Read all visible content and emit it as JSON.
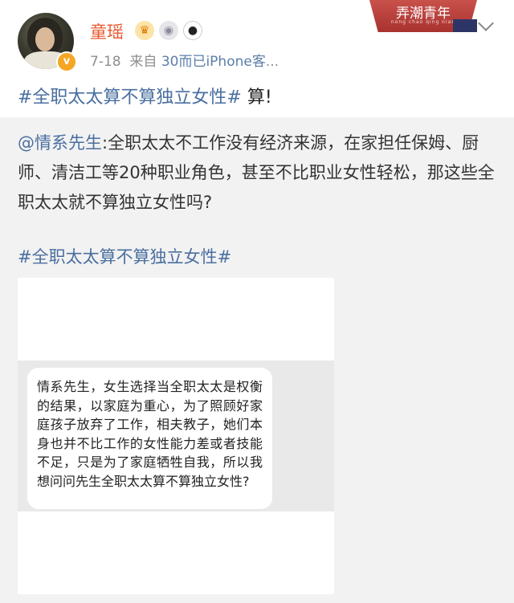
{
  "banner": {
    "title": "弄潮青年",
    "subtitle": "nong chao qing nian"
  },
  "author": {
    "name": "童瑶",
    "verified_mark": "v",
    "badges": [
      "crown-icon",
      "medal-icon",
      "panda-icon"
    ],
    "time": "7-18",
    "source_prefix": "来自",
    "source": "30而已iPhone客",
    "ellipsis": "..."
  },
  "post": {
    "hashtag": "#全职太太算不算独立女性#",
    "text": " 算!"
  },
  "repost": {
    "mention": "@情系先生",
    "body": ":全职太太不工作没有经济来源，在家担任保姆、厨师、清洁工等20种职业角色，甚至不比职业女性轻松，那这些全职太太就不算独立女性吗?",
    "hashtag": "#全职太太算不算独立女性#"
  },
  "screenshot": {
    "message": "情系先生，女生选择当全职太太是权衡的结果，以家庭为重心，为了照顾好家庭孩子放弃了工作，相夫教子，她们本身也并不比工作的女性能力差或者技能不足，只是为了家庭牺牲自我，所以我想问问先生全职太太算不算独立女性?"
  },
  "colors": {
    "username": "#e8582f",
    "link": "#4a6fa0",
    "repost_bg": "#f2f2f2",
    "banner": "#a8322f"
  }
}
